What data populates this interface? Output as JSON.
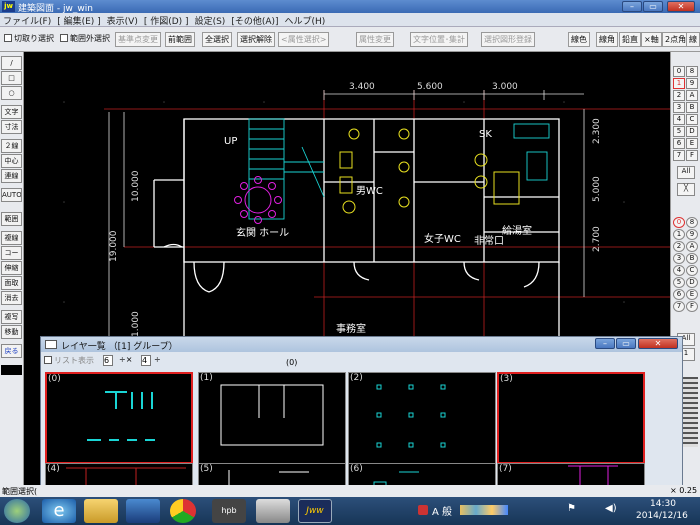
{
  "window": {
    "title": "建築図面 - jw_win",
    "icon_text": "jw"
  },
  "menu": [
    "ファイル(F)",
    "[ 編集(E) ]",
    "表示(V)",
    "[ 作図(D) ]",
    "設定(S)",
    "[その他(A)]",
    "ヘルプ(H)"
  ],
  "toolbar": {
    "cut_select": "切取り選択",
    "out_of_range": "範囲外選択",
    "base_change": "基準点変更",
    "prev_range": "前範囲",
    "select_all": "全選択",
    "deselect": "選択解除",
    "attr_select": "<属性選択>",
    "attr_change": "属性変更",
    "text_pos": "文字位置･集計",
    "register": "選択図形登録",
    "right_buttons": [
      "線色",
      "線角",
      "鉛直",
      "×軸",
      "2点角",
      "線"
    ]
  },
  "left_tools": [
    "/",
    "□",
    "○",
    "文字",
    "寸法",
    "２線",
    "中心線",
    "連線",
    "AUTO",
    "範囲",
    "複線",
    "コーナー",
    "伸縮",
    "面取",
    "消去",
    "複写",
    "移動",
    "戻る"
  ],
  "right_layers": {
    "top": [
      "0",
      "8",
      "1",
      "9",
      "2",
      "A",
      "3",
      "B",
      "4",
      "C",
      "5",
      "D",
      "6",
      "E",
      "7",
      "F"
    ],
    "all_label": "All",
    "x_label": "╳",
    "groups": [
      "0",
      "8",
      "1",
      "9",
      "2",
      "A",
      "3",
      "B",
      "4",
      "C",
      "5",
      "D",
      "6",
      "E",
      "7",
      "F"
    ],
    "all2_label": "All",
    "num": "1"
  },
  "drawing": {
    "dims_top": [
      "3.400",
      "5.600",
      "3.000"
    ],
    "dims_left": [
      "10.000",
      "19.000",
      "1.000"
    ],
    "dims_right": [
      "2.300",
      "5.000",
      "2.700"
    ],
    "labels": {
      "up": "UP",
      "sk": "SK",
      "men_wc": "男WC",
      "women_wc": "女子WC",
      "kyuto": "給湯室",
      "entrance": "玄関 ホール",
      "emergency": "非常口",
      "office": "事務室"
    }
  },
  "layer_dialog": {
    "title": "レイヤ一覧 （[1] グループ）",
    "list_view": "リスト表示",
    "cols": "6",
    "rows": "4",
    "header": "(0)",
    "thumbs_top": [
      "(0)",
      "(1)",
      "(2)",
      "(3)"
    ],
    "thumbs_bottom": [
      "(4)",
      "(5)",
      "(6)",
      "(7)"
    ]
  },
  "status": {
    "left": "範囲選択(",
    "zoom": "× 0.25"
  },
  "clock": {
    "time": "14:30",
    "date": "2014/12/16"
  },
  "tray_text": "A 般",
  "taskbar_icons": [
    "start",
    "ie",
    "explorer",
    "media",
    "chrome",
    "hpb",
    "paint",
    "jww"
  ]
}
